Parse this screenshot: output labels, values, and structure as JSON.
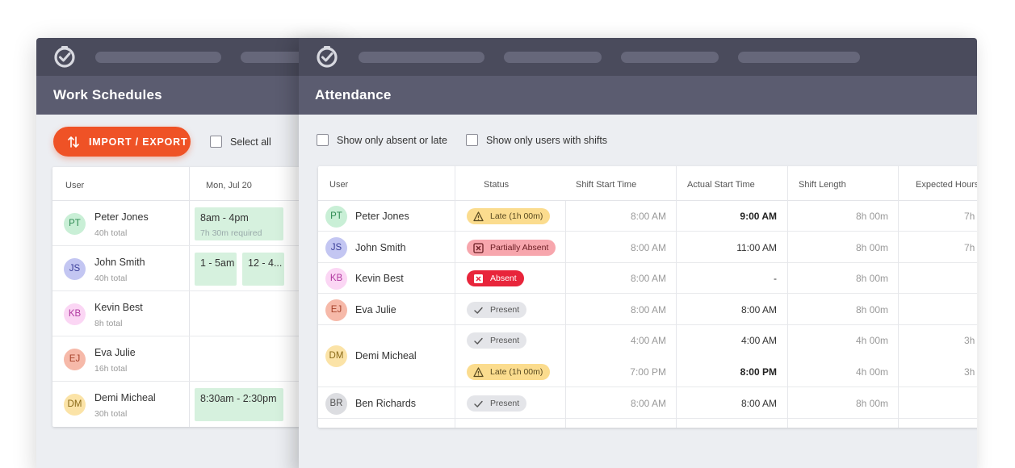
{
  "work_schedules": {
    "title": "Work Schedules",
    "import_export_label": "IMPORT / EXPORT",
    "select_all_label": "Select all",
    "columns": {
      "user": "User",
      "day": "Mon, Jul 20"
    },
    "rows": [
      {
        "initials": "PT",
        "name": "Peter Jones",
        "total": "40h total",
        "shifts": [
          {
            "time": "8am - 4pm",
            "note": "7h 30m required"
          }
        ]
      },
      {
        "initials": "JS",
        "name": "John Smith",
        "total": "40h total",
        "shifts": [
          {
            "time": "1 - 5am"
          },
          {
            "time": "12 - 4..."
          }
        ]
      },
      {
        "initials": "KB",
        "name": "Kevin Best",
        "total": "8h total",
        "shifts": []
      },
      {
        "initials": "EJ",
        "name": "Eva Julie",
        "total": "16h total",
        "shifts": []
      },
      {
        "initials": "DM",
        "name": "Demi Micheal",
        "total": "30h total",
        "shifts": [
          {
            "time": "8:30am - 2:30pm"
          }
        ]
      }
    ]
  },
  "attendance": {
    "title": "Attendance",
    "filters": {
      "absent_or_late": "Show only absent or late",
      "users_with_shifts": "Show only users with shifts"
    },
    "columns": {
      "user": "User",
      "status": "Status",
      "shift_start": "Shift Start Time",
      "actual_start": "Actual Start Time",
      "shift_length": "Shift Length",
      "expected_hours": "Expected Hours"
    },
    "rows": [
      {
        "initials": "PT",
        "name": "Peter Jones",
        "status": "Late (1h 00m)",
        "status_type": "late",
        "shift_start": "8:00 AM",
        "actual_start": "9:00 AM",
        "actual_bold": true,
        "shift_length": "8h 00m",
        "expected": "7h"
      },
      {
        "initials": "JS",
        "name": "John Smith",
        "status": "Partially Absent",
        "status_type": "partial",
        "shift_start": "8:00 AM",
        "actual_start": "11:00 AM",
        "actual_bold": false,
        "shift_length": "8h 00m",
        "expected": "7h"
      },
      {
        "initials": "KB",
        "name": "Kevin Best",
        "status": "Absent",
        "status_type": "absent",
        "shift_start": "8:00 AM",
        "actual_start": "-",
        "actual_bold": false,
        "shift_length": "8h 00m",
        "expected": ""
      },
      {
        "initials": "EJ",
        "name": "Eva Julie",
        "status": "Present",
        "status_type": "present",
        "shift_start": "8:00 AM",
        "actual_start": "8:00 AM",
        "actual_bold": false,
        "shift_length": "8h 00m",
        "expected": ""
      },
      {
        "initials": "DM",
        "name": "Demi Micheal",
        "status": "Present",
        "status_type": "present",
        "shift_start": "4:00 AM",
        "actual_start": "4:00 AM",
        "actual_bold": false,
        "shift_length": "4h 00m",
        "expected": "3h"
      },
      {
        "initials": "",
        "name": "",
        "status": "Late (1h 00m)",
        "status_type": "late",
        "shift_start": "7:00 PM",
        "actual_start": "8:00 PM",
        "actual_bold": true,
        "shift_length": "4h 00m",
        "expected": "3h"
      },
      {
        "initials": "BR",
        "name": "Ben Richards",
        "status": "Present",
        "status_type": "present",
        "shift_start": "8:00 AM",
        "actual_start": "8:00 AM",
        "actual_bold": false,
        "shift_length": "8h 00m",
        "expected": ""
      }
    ]
  },
  "avatar_colors": {
    "PT": {
      "bg": "#c9efd6",
      "fg": "#2e8a52"
    },
    "JS": {
      "bg": "#c3c6f2",
      "fg": "#3b3f9a"
    },
    "KB": {
      "bg": "#fbd6f4",
      "fg": "#b03aa0"
    },
    "EJ": {
      "bg": "#f6b9a9",
      "fg": "#a6412a"
    },
    "DM": {
      "bg": "#fbe3a7",
      "fg": "#8a6a18"
    },
    "BR": {
      "bg": "#dcdde1",
      "fg": "#555"
    }
  },
  "colors": {
    "topbar": "#4a4b5c",
    "titlebar": "#5b5c70",
    "accent": "#ef5226"
  }
}
